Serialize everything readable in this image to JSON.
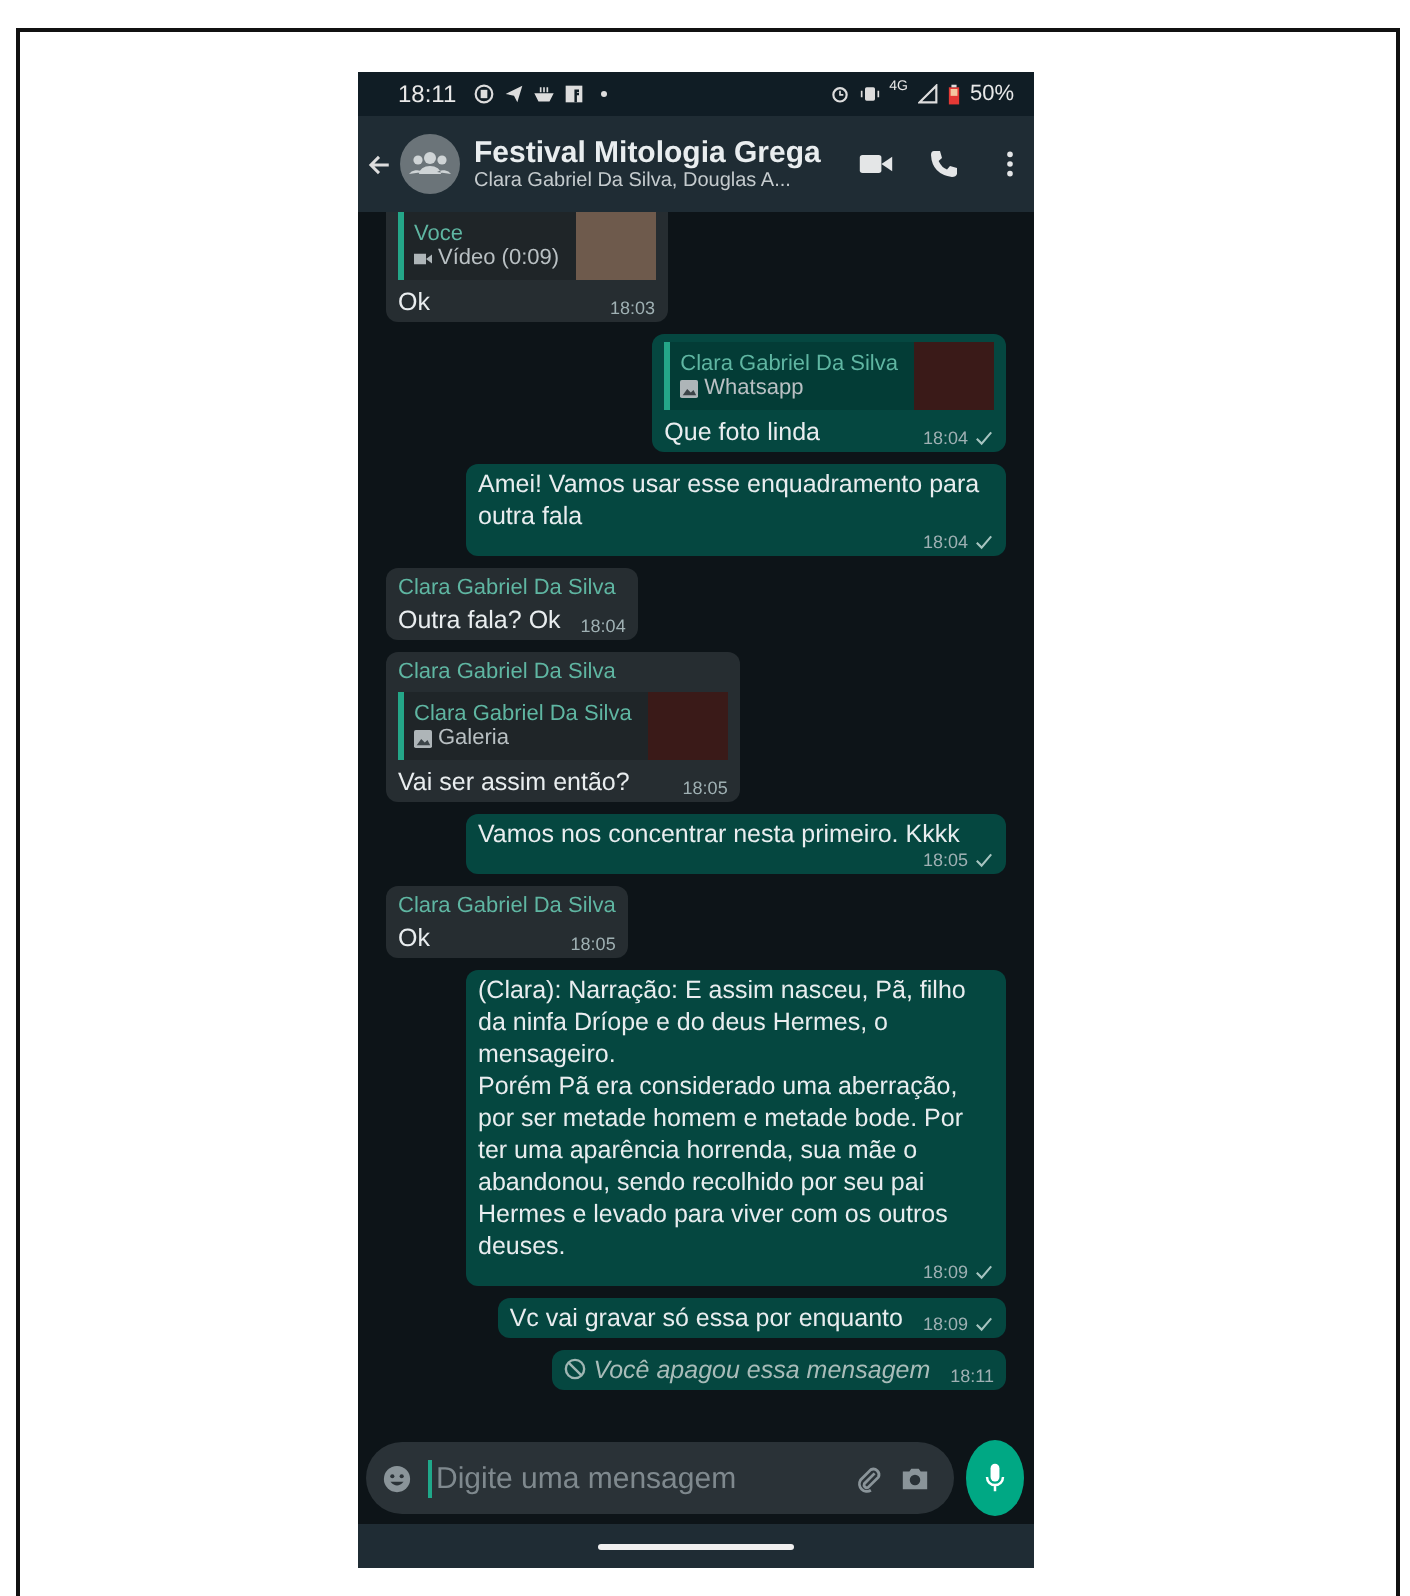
{
  "status_bar": {
    "time": "18:11",
    "network": "4G",
    "battery": "50%"
  },
  "header": {
    "title": "Festival Mitologia Grega",
    "subtitle": "Clara Gabriel Da Silva, Douglas A..."
  },
  "messages": [
    {
      "kind": "incoming",
      "quote": {
        "sender": "Voce",
        "label": "Vídeo (0:09)",
        "kind": "video"
      },
      "text": "Ok",
      "time": "18:03"
    },
    {
      "kind": "outgoing",
      "quote": {
        "sender": "Clara Gabriel Da Silva",
        "label": "Whatsapp",
        "kind": "photo"
      },
      "text": "Que foto linda",
      "time": "18:04",
      "ticked": true
    },
    {
      "kind": "outgoing",
      "text": "Amei! Vamos usar esse enquadramento para outra fala",
      "time": "18:04",
      "ticked": true
    },
    {
      "kind": "incoming",
      "sender": "Clara Gabriel Da Silva",
      "text": "Outra fala? Ok",
      "time": "18:04"
    },
    {
      "kind": "incoming",
      "sender": "Clara Gabriel Da Silva",
      "quote": {
        "sender": "Clara Gabriel Da Silva",
        "label": "Galeria",
        "kind": "photo"
      },
      "text": "Vai ser assim então?",
      "time": "18:05"
    },
    {
      "kind": "outgoing",
      "text": "Vamos nos concentrar nesta primeiro. Kkkk",
      "time": "18:05",
      "ticked": true
    },
    {
      "kind": "incoming",
      "sender": "Clara Gabriel Da Silva",
      "text": "Ok",
      "time": "18:05"
    },
    {
      "kind": "outgoing",
      "text": "(Clara): Narração: E assim nasceu, Pã, filho da ninfa Dríope e do deus Hermes, o mensageiro.\nPorém Pã era considerado uma aberração, por ser metade homem e metade bode. Por ter uma aparência horrenda, sua mãe o abandonou, sendo recolhido por seu pai Hermes e levado para viver com os outros deuses.",
      "time": "18:09",
      "ticked": true
    },
    {
      "kind": "outgoing",
      "text": "Vc vai gravar só essa por enquanto",
      "time": "18:09",
      "ticked": true
    },
    {
      "kind": "deleted",
      "text": "Você apagou essa mensagem",
      "time": "18:11",
      "ticked": false
    }
  ],
  "composer": {
    "placeholder": "Digite uma mensagem"
  }
}
